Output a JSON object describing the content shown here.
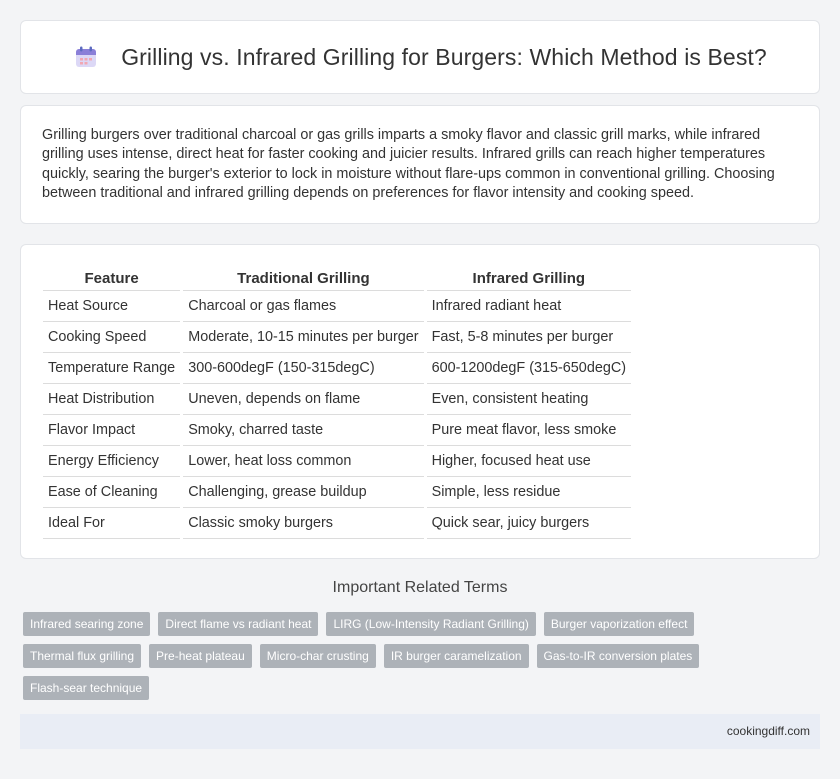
{
  "header": {
    "title": "Grilling vs. Infrared Grilling for Burgers: Which Method is Best?"
  },
  "intro": {
    "text": "Grilling burgers over traditional charcoal or gas grills imparts a smoky flavor and classic grill marks, while infrared grilling uses intense, direct heat for faster cooking and juicier results. Infrared grills can reach higher temperatures quickly, searing the burger's exterior to lock in moisture without flare-ups common in conventional grilling. Choosing between traditional and infrared grilling depends on preferences for flavor intensity and cooking speed."
  },
  "table": {
    "headers": [
      "Feature",
      "Traditional Grilling",
      "Infrared Grilling"
    ],
    "rows": [
      [
        "Heat Source",
        "Charcoal or gas flames",
        "Infrared radiant heat"
      ],
      [
        "Cooking Speed",
        "Moderate, 10-15 minutes per burger",
        "Fast, 5-8 minutes per burger"
      ],
      [
        "Temperature Range",
        "300-600degF (150-315degC)",
        "600-1200degF (315-650degC)"
      ],
      [
        "Heat Distribution",
        "Uneven, depends on flame",
        "Even, consistent heating"
      ],
      [
        "Flavor Impact",
        "Smoky, charred taste",
        "Pure meat flavor, less smoke"
      ],
      [
        "Energy Efficiency",
        "Lower, heat loss common",
        "Higher, focused heat use"
      ],
      [
        "Ease of Cleaning",
        "Challenging, grease buildup",
        "Simple, less residue"
      ],
      [
        "Ideal For",
        "Classic smoky burgers",
        "Quick sear, juicy burgers"
      ]
    ]
  },
  "related": {
    "title": "Important Related Terms",
    "tags": [
      "Infrared searing zone",
      "Direct flame vs radiant heat",
      "LIRG (Low-Intensity Radiant Grilling)",
      "Burger vaporization effect",
      "Thermal flux grilling",
      "Pre-heat plateau",
      "Micro-char crusting",
      "IR burger caramelization",
      "Gas-to-IR conversion plates",
      "Flash-sear technique"
    ]
  },
  "footer": {
    "site": "cookingdiff.com"
  },
  "colors": {
    "tag_bg": "#adb2b8",
    "footer_bg": "#e9edf5",
    "calendar_accent": "#8a7fd8"
  },
  "icons": {
    "header_icon": "calendar-icon"
  }
}
